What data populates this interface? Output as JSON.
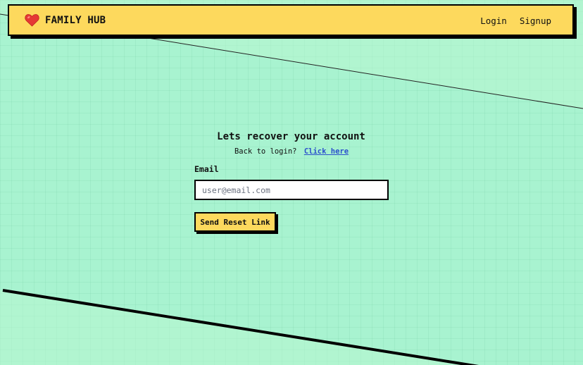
{
  "navbar": {
    "brand": "FAMILY HUB",
    "brand_icon": "heart-icon",
    "links": [
      "Login",
      "Signup"
    ]
  },
  "recovery_form": {
    "title": "Lets recover your account",
    "subtitle_prefix": "Back to login?",
    "subtitle_link": "Click here",
    "email_label": "Email",
    "email_placeholder": "user@email.com",
    "email_value": "",
    "submit_label": "Send Reset Link"
  },
  "colors": {
    "background": "#a8f3d0",
    "accent_yellow": "#fdd95d",
    "border": "#000000",
    "link": "#2b4fcc",
    "heart": "#e53935"
  }
}
